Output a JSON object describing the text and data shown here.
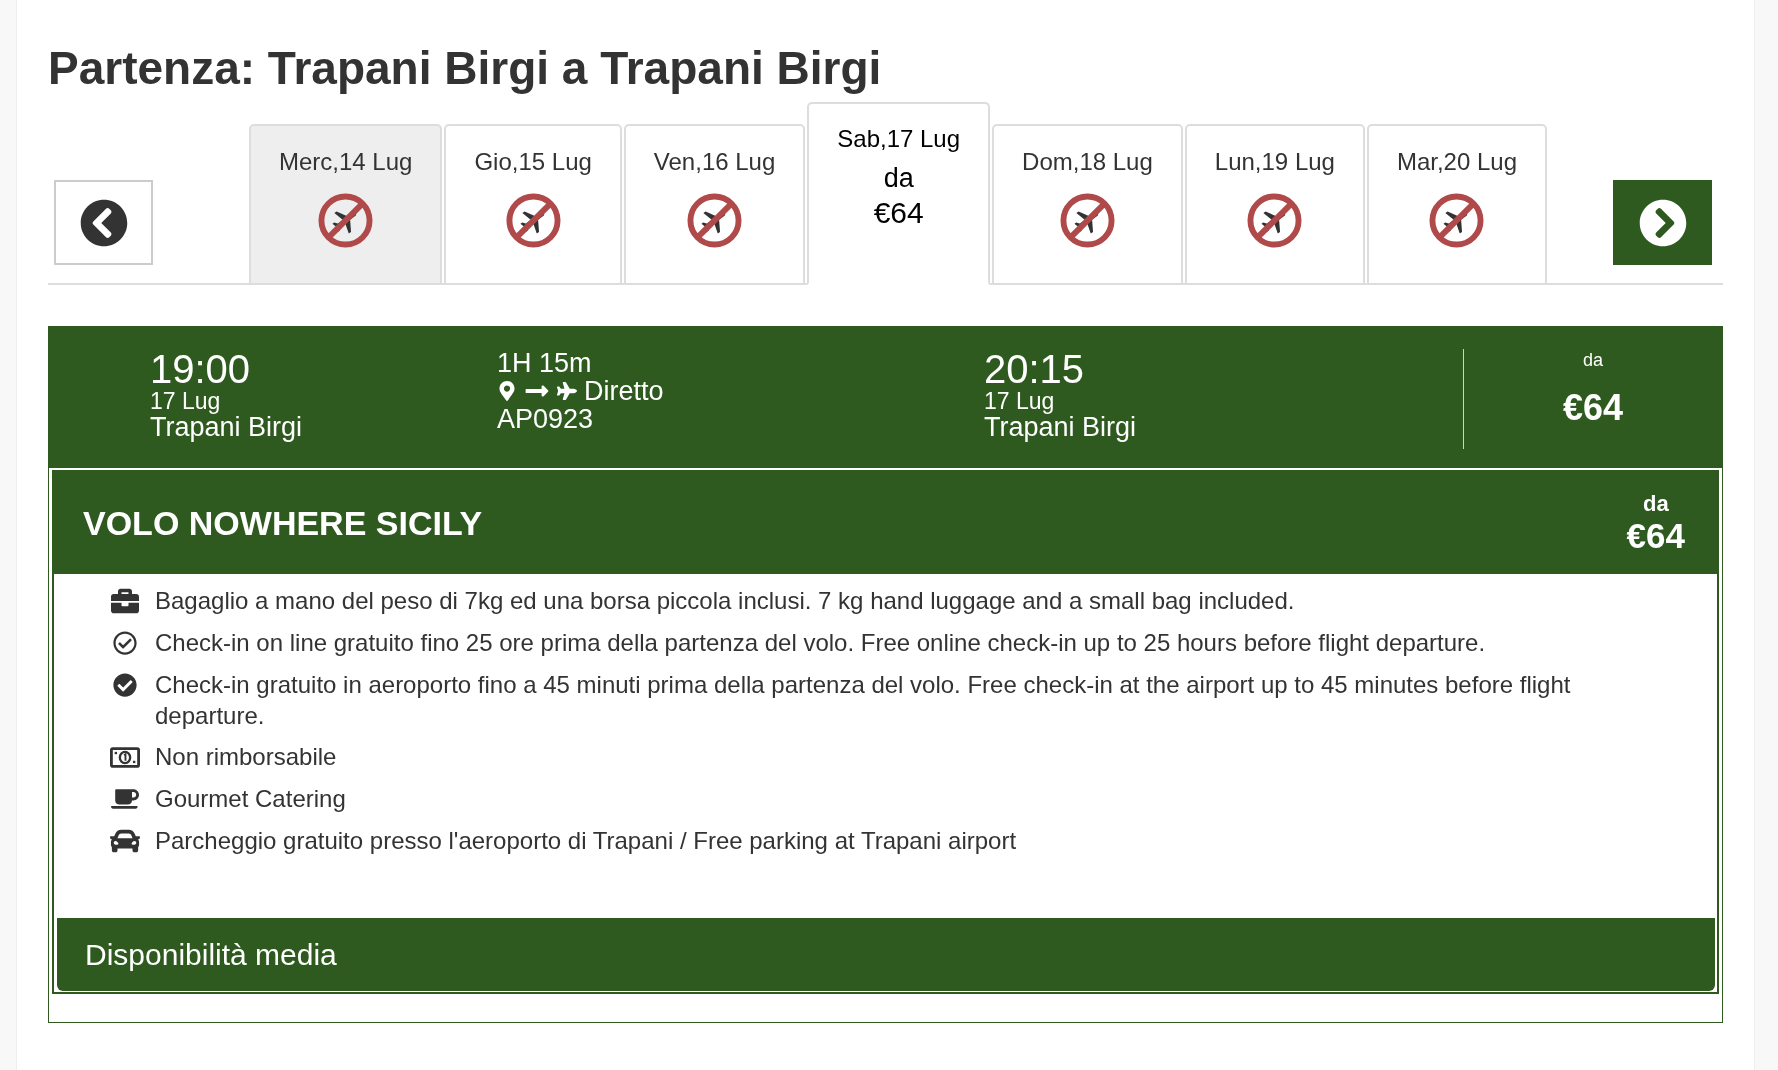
{
  "title": "Partenza: Trapani Birgi a Trapani Birgi",
  "date_tabs": [
    {
      "label": "Merc,14 Lug",
      "kind": "no-flights",
      "selected": false,
      "highlighted": true
    },
    {
      "label": "Gio,15 Lug",
      "kind": "no-flights",
      "selected": false,
      "highlighted": false
    },
    {
      "label": "Ven,16 Lug",
      "kind": "no-flights",
      "selected": false,
      "highlighted": false
    },
    {
      "label": "Sab,17 Lug",
      "kind": "fare",
      "selected": true,
      "highlighted": false,
      "price_prefix": "da",
      "price": "€64"
    },
    {
      "label": "Dom,18 Lug",
      "kind": "no-flights",
      "selected": false,
      "highlighted": false
    },
    {
      "label": "Lun,19 Lug",
      "kind": "no-flights",
      "selected": false,
      "highlighted": false
    },
    {
      "label": "Mar,20 Lug",
      "kind": "no-flights",
      "selected": false,
      "highlighted": false
    }
  ],
  "flight": {
    "departure": {
      "time": "19:00",
      "date": "17 Lug",
      "airport": "Trapani Birgi"
    },
    "duration": "1H 15m",
    "stops": "Diretto",
    "flight_number": "AP0923",
    "arrival": {
      "time": "20:15",
      "date": "17 Lug",
      "airport": "Trapani Birgi"
    },
    "price_prefix": "da",
    "price": "€64"
  },
  "fare": {
    "name": "VOLO NOWHERE SICILY",
    "price_prefix": "da",
    "price": "€64",
    "features": [
      {
        "kind": "baggage",
        "text": "Bagaglio a mano del peso di 7kg ed una borsa piccola inclusi. 7 kg hand luggage and a small bag included."
      },
      {
        "kind": "online-checkin",
        "text": "Check-in on line gratuito fino 25 ore prima della partenza del volo. Free online check-in up to 25 hours before flight departure."
      },
      {
        "kind": "airport-checkin",
        "text": "Check-in gratuito in aeroporto fino a 45 minuti prima della partenza del volo. Free check-in at the airport up to 45 minutes before flight departure."
      },
      {
        "kind": "refund",
        "text": "Non rimborsabile"
      },
      {
        "kind": "catering",
        "text": "Gourmet Catering"
      },
      {
        "kind": "parking",
        "text": "Parcheggio gratuito presso l'aeroporto di Trapani / Free parking at Trapani airport"
      }
    ],
    "availability": "Disponibilità media"
  }
}
